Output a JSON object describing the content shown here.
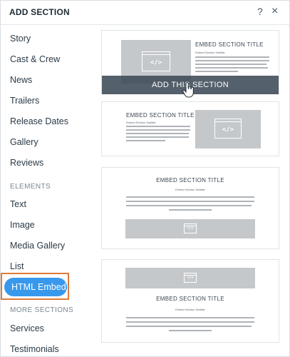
{
  "header": {
    "title": "ADD SECTION",
    "help_label": "?",
    "close_label": "×"
  },
  "sidebar": {
    "items_top": [
      "Story",
      "Cast & Crew",
      "News",
      "Trailers",
      "Release Dates",
      "Gallery",
      "Reviews"
    ],
    "elements_label": "ELEMENTS",
    "elements": [
      "Text",
      "Image",
      "Media Gallery",
      "List"
    ],
    "selected": "HTML Embed",
    "more_label": "MORE SECTIONS",
    "more": [
      "Services",
      "Testimonials"
    ]
  },
  "cards": {
    "title": "EMBED SECTION TITLE",
    "subtitle": "Embed Section Subtitle",
    "add_label": "ADD THIS SECTION",
    "code_glyph": "</>"
  },
  "colors": {
    "accent": "#3899ec",
    "highlight_border": "#e07b39",
    "placeholder": "#c5c8cb",
    "overlay": "#3c4a56"
  }
}
